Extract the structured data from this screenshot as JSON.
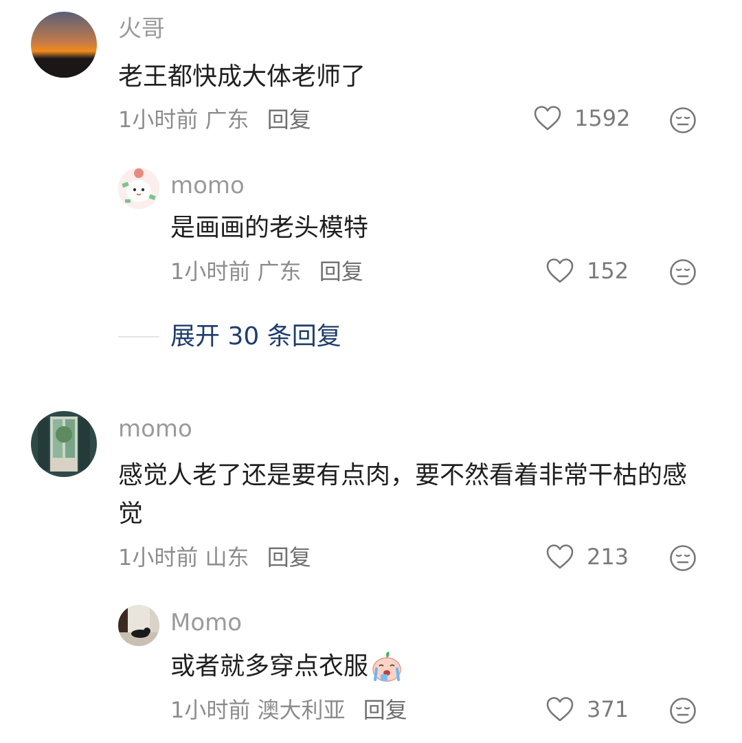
{
  "comments": [
    {
      "user": "火哥",
      "text": "老王都快成大体老师了",
      "time": "1小时前",
      "location": "广东",
      "reply_label": "回复",
      "likes": "1592",
      "replies": [
        {
          "user": "momo",
          "text": "是画画的老头模特",
          "time": "1小时前",
          "location": "广东",
          "reply_label": "回复",
          "likes": "152"
        }
      ],
      "expand_label": "展开 30 条回复"
    },
    {
      "user": "momo",
      "text": "感觉人老了还是要有点肉，要不然看着非常干枯的感觉",
      "time": "1小时前",
      "location": "山东",
      "reply_label": "回复",
      "likes": "213",
      "replies": [
        {
          "user": "Momo",
          "text": "或者就多穿点衣服",
          "time": "1小时前",
          "location": "澳大利亚",
          "reply_label": "回复",
          "likes": "371"
        }
      ]
    }
  ],
  "icons": {
    "like": "heart-outline-icon",
    "dislike": "meh-face-icon",
    "emoji": "crying-emoji-icon"
  },
  "colors": {
    "expand_link": "#1e3d6b",
    "username": "#9a9a9a",
    "meta": "#8c8c8c"
  }
}
